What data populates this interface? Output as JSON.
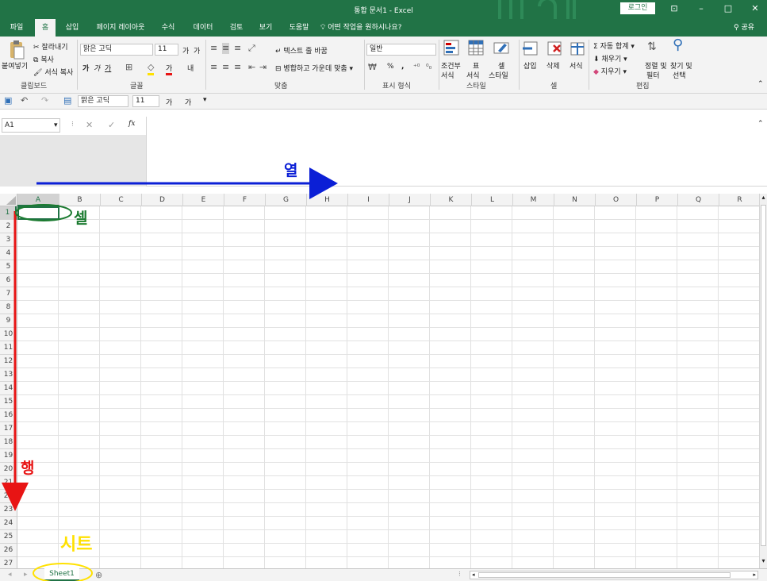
{
  "window": {
    "title": "통합 문서1  -  Excel",
    "login": "로그인"
  },
  "tabs": [
    {
      "label": "파일",
      "active": false
    },
    {
      "label": "홈",
      "active": true
    },
    {
      "label": "삽입",
      "active": false
    },
    {
      "label": "페이지 레이아웃",
      "active": false
    },
    {
      "label": "수식",
      "active": false
    },
    {
      "label": "데이터",
      "active": false
    },
    {
      "label": "검토",
      "active": false
    },
    {
      "label": "보기",
      "active": false
    },
    {
      "label": "도움말",
      "active": false
    }
  ],
  "tell_me": "어떤 작업을 원하시나요?",
  "share": "공유",
  "ribbon": {
    "clipboard": {
      "paste": "붙여넣기",
      "cut": "잘라내기",
      "copy": "복사",
      "format_painter": "서식 복사",
      "group": "클립보드"
    },
    "font": {
      "name": "맑은 고딕",
      "size": "11",
      "bold": "가",
      "italic": "가",
      "underline": "가",
      "grow": "가",
      "shrink": "가",
      "color_a": "가",
      "phonetic": "내",
      "group": "글꼴"
    },
    "align": {
      "wrap": "텍스트 줄 바꿈",
      "merge": "병합하고 가운데 맞춤",
      "group": "맞춤"
    },
    "number": {
      "format": "일반",
      "percent": "%",
      "comma": ",",
      "group": "표시 형식"
    },
    "styles": {
      "cond": "조건부",
      "cond2": "서식",
      "table": "표",
      "table2": "서식",
      "cell": "셀",
      "cell2": "스타일",
      "group": "스타일"
    },
    "cells": {
      "insert": "삽입",
      "delete": "삭제",
      "format": "서식",
      "group": "셀"
    },
    "edit": {
      "autosum": "자동 합계",
      "fill": "채우기",
      "clear": "지우기",
      "sort": "정렬 및",
      "sort2": "필터",
      "find": "찾기 및",
      "find2": "선택",
      "group": "편집"
    }
  },
  "qat": {
    "font": "맑은 고딕",
    "size": "11",
    "grow": "가",
    "shrink": "가"
  },
  "formula": {
    "namebox": "A1",
    "fx": "fx"
  },
  "columns": [
    "A",
    "B",
    "C",
    "D",
    "E",
    "F",
    "G",
    "H",
    "I",
    "J",
    "K",
    "L",
    "M",
    "N",
    "O",
    "P",
    "Q",
    "R"
  ],
  "rows": [
    "1",
    "2",
    "3",
    "4",
    "5",
    "6",
    "7",
    "8",
    "9",
    "10",
    "11",
    "12",
    "13",
    "14",
    "15",
    "16",
    "17",
    "18",
    "19",
    "20",
    "21",
    "22",
    "23",
    "24",
    "25",
    "26",
    "27"
  ],
  "sheet": {
    "name": "Sheet1"
  },
  "annotations": {
    "column": "열",
    "row": "행",
    "cell": "셀",
    "sheet": "시트"
  },
  "colors": {
    "excel_green": "#217346",
    "column_arrow": "#0b1fd6",
    "row_arrow": "#e81414",
    "cell_mark": "#1a7a2f",
    "sheet_mark": "#ffe100"
  }
}
